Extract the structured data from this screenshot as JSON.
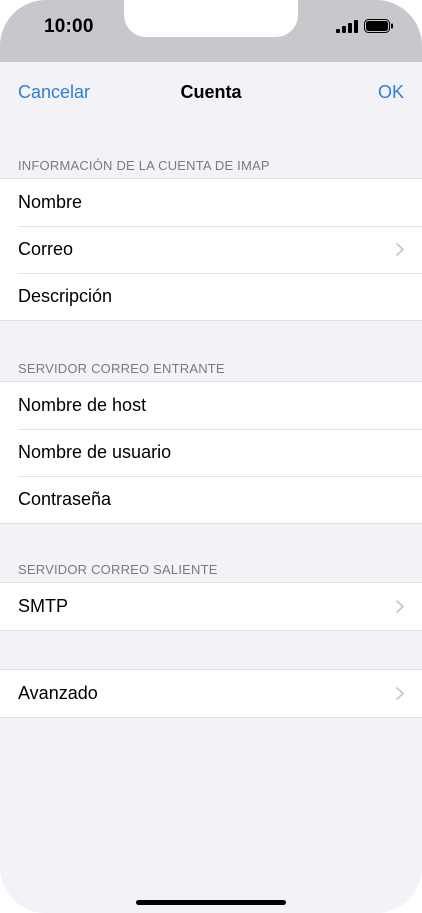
{
  "status_bar": {
    "time": "10:00",
    "signal_icon": "cellular-signal-icon",
    "battery_icon": "battery-icon"
  },
  "nav": {
    "cancel_label": "Cancelar",
    "title": "Cuenta",
    "ok_label": "OK"
  },
  "sections": [
    {
      "header": "INFORMACIÓN DE LA CUENTA DE IMAP",
      "rows": [
        {
          "label": "Nombre",
          "chevron": false
        },
        {
          "label": "Correo",
          "chevron": true
        },
        {
          "label": "Descripción",
          "chevron": false
        }
      ]
    },
    {
      "header": "SERVIDOR CORREO ENTRANTE",
      "rows": [
        {
          "label": "Nombre de host",
          "chevron": false
        },
        {
          "label": "Nombre de usuario",
          "chevron": false
        },
        {
          "label": "Contraseña",
          "chevron": false
        }
      ]
    },
    {
      "header": "SERVIDOR CORREO SALIENTE",
      "rows": [
        {
          "label": "SMTP",
          "chevron": true
        }
      ]
    },
    {
      "header": "",
      "rows": [
        {
          "label": "Avanzado",
          "chevron": true
        }
      ]
    }
  ],
  "colors": {
    "accent": "#2f7fd6",
    "background": "#f2f2f7",
    "section_header": "#7a7a80",
    "chevron": "#c4c4c7"
  }
}
